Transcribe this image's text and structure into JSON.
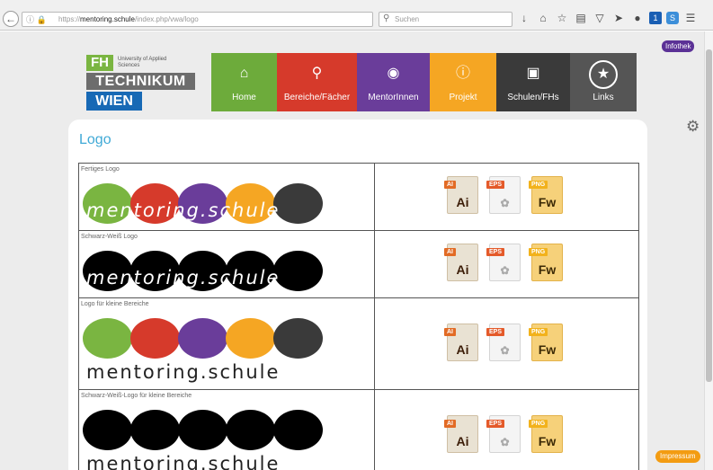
{
  "browser": {
    "url_prefix": "https://",
    "url_host": "mentoring.schule",
    "url_path": "/index.php/vwa/logo",
    "search_placeholder": "Suchen",
    "toolbar_badge": "1"
  },
  "header": {
    "logo": {
      "fh": "FH",
      "small": "University of Applied Sciences",
      "technikum": "TECHNIKUM",
      "wien": "WIEN"
    },
    "nav": [
      {
        "label": "Home",
        "icon": "home-icon",
        "color": "#6dab3b"
      },
      {
        "label": "Bereiche/Fächer",
        "icon": "search-icon",
        "color": "#d63a2b"
      },
      {
        "label": "MentorInnen",
        "icon": "globe-icon",
        "color": "#6a3d9a"
      },
      {
        "label": "Projekt",
        "icon": "info-icon",
        "color": "#f5a623"
      },
      {
        "label": "Schulen/FHs",
        "icon": "rss-icon",
        "color": "#3a3a3a"
      },
      {
        "label": "Links",
        "icon": "star-icon",
        "color": "#555555"
      }
    ],
    "bibliothek": "Infothek"
  },
  "page": {
    "title": "Logo",
    "impressum": "Impressum"
  },
  "logo_table": {
    "rows": [
      {
        "caption": "Fertiges Logo",
        "wordmark": "mentoring.schule",
        "style": "color-overlay",
        "files": [
          "AI",
          "EPS",
          "PNG"
        ]
      },
      {
        "caption": "Schwarz-Weiß Logo",
        "wordmark": "mentoring.schule",
        "style": "black-overlay",
        "files": [
          "AI",
          "EPS",
          "PNG"
        ]
      },
      {
        "caption": "Logo für kleine Bereiche",
        "wordmark": "mentoring.schule",
        "style": "color-below",
        "files": [
          "AI",
          "EPS",
          "PNG"
        ]
      },
      {
        "caption": "Schwarz-Weiß-Logo für kleine Bereiche",
        "wordmark": "mentoring.schule",
        "style": "black-below",
        "files": [
          "AI",
          "EPS",
          "PNG"
        ]
      }
    ],
    "file_labels": {
      "ai": "Ai",
      "eps": "",
      "png": "Fw"
    },
    "circle_colors": [
      "#7ab541",
      "#d63a2b",
      "#6a3d9a",
      "#f5a623",
      "#3a3a3a"
    ]
  }
}
